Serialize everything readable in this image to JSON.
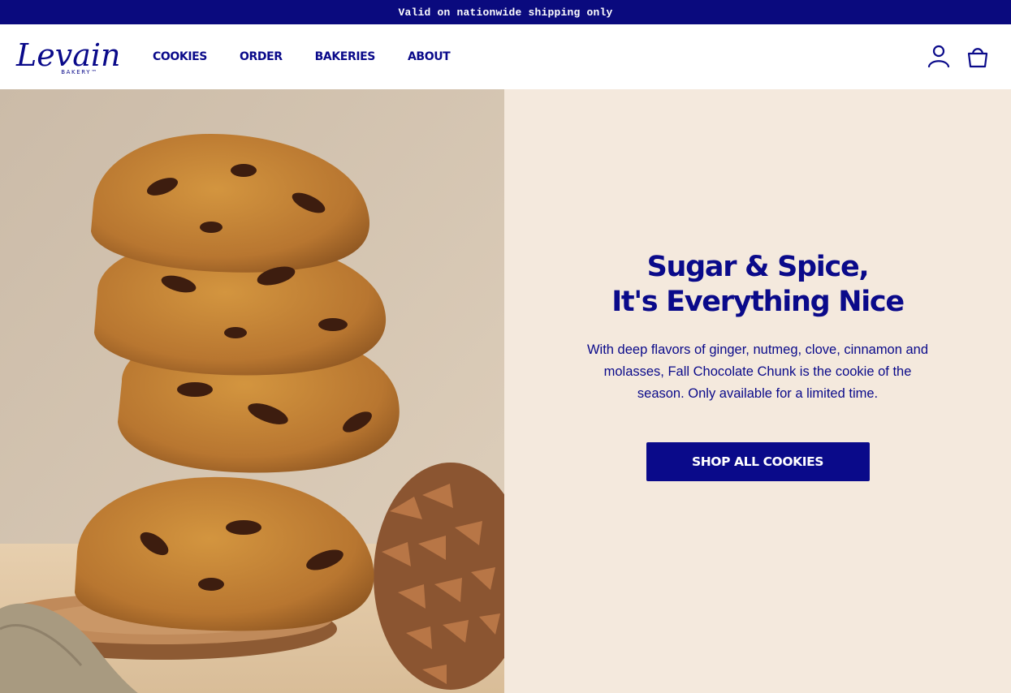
{
  "announcement": "Valid on nationwide shipping only",
  "brand": {
    "name": "Levain",
    "sub": "BAKERY™"
  },
  "nav": [
    {
      "label": "COOKIES"
    },
    {
      "label": "ORDER"
    },
    {
      "label": "BAKERIES"
    },
    {
      "label": "ABOUT"
    }
  ],
  "icons": {
    "account": "user-icon",
    "cart": "shopping-bag-icon"
  },
  "hero": {
    "headline_line1": "Sugar & Spice,",
    "headline_line2": "It's Everything Nice",
    "body": "With deep flavors of ginger, nutmeg, clove, cinnamon and molasses, Fall Chocolate Chunk is the cookie of the season. Only available for a limited time.",
    "cta": "SHOP ALL COOKIES"
  },
  "colors": {
    "brand_navy": "#0a0a8a",
    "announcement_bg": "#0a0a7e",
    "hero_panel_bg": "#f4e9dd"
  }
}
